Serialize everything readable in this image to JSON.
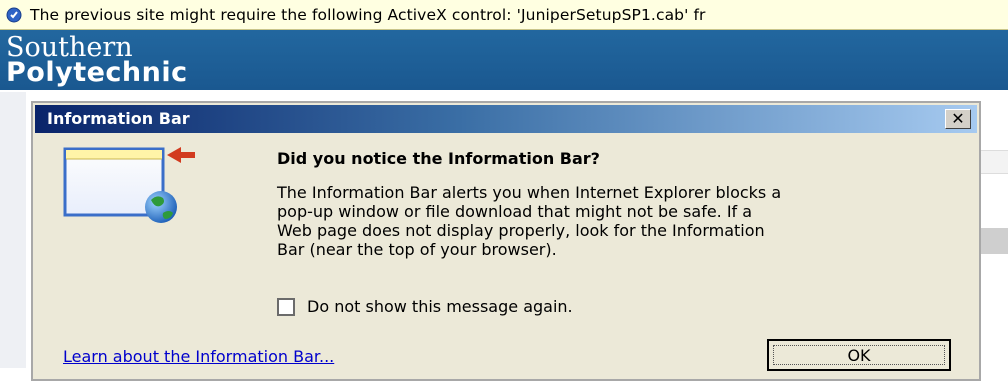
{
  "info_bar": {
    "text": "The previous site might require the following ActiveX control: 'JuniperSetupSP1.cab' fr",
    "icon": "info-shield-icon"
  },
  "site": {
    "logo_top": "Southern",
    "logo_bottom": "Polytechnic",
    "header_color": "#1c5f9e"
  },
  "dialog": {
    "title": "Information Bar",
    "close_label": "✕",
    "heading": "Did you notice the Information Bar?",
    "body_lines": [
      "The Information Bar alerts you when Internet Explorer blocks a",
      "pop-up window or file download that might not be safe. If a",
      "Web page does not display properly, look for the Information",
      "Bar (near the top of your browser)."
    ],
    "checkbox_label": "Do not show this message again.",
    "checkbox_checked": false,
    "link_text": "Learn about the Information Bar...",
    "ok_label": "OK",
    "graphic_icon": "information-bar-illustration-icon"
  }
}
